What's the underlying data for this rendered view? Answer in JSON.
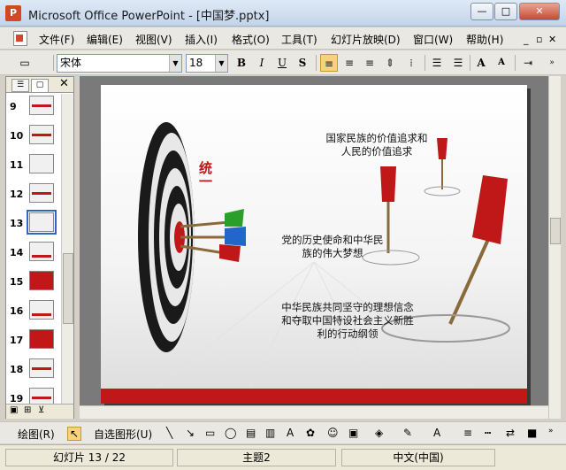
{
  "window": {
    "title": "Microsoft Office PowerPoint - [中国梦.pptx]"
  },
  "menu": {
    "items": [
      "文件(F)",
      "编辑(E)",
      "视图(V)",
      "插入(I)",
      "格式(O)",
      "工具(T)",
      "幻灯片放映(D)",
      "窗口(W)",
      "帮助(H)"
    ]
  },
  "format_toolbar": {
    "font_name": "宋体",
    "font_size": "18",
    "bold": "B",
    "italic": "I",
    "underline": "U",
    "shadow": "S"
  },
  "slide_pane": {
    "thumbnails": [
      {
        "num": "9"
      },
      {
        "num": "10"
      },
      {
        "num": "11"
      },
      {
        "num": "12"
      },
      {
        "num": "13"
      },
      {
        "num": "14"
      },
      {
        "num": "15"
      },
      {
        "num": "16"
      },
      {
        "num": "17"
      },
      {
        "num": "18"
      },
      {
        "num": "19"
      }
    ],
    "selected": "13"
  },
  "slide": {
    "vertical_title": "统一",
    "text1": [
      "国家民族的价值追求和",
      "人民的价值追求"
    ],
    "text2": [
      "党的历史使命和中华民",
      "族的伟大梦想"
    ],
    "text3": [
      "中华民族共同坚守的理想信念",
      "和夺取中国特设社会主义新胜",
      "利的行动纲领"
    ]
  },
  "draw_toolbar": {
    "draw_label": "绘图(R)",
    "autoshape_label": "自选图形(U)"
  },
  "status": {
    "slide_info": "幻灯片 13 / 22",
    "theme": "主题2",
    "language": "中文(中国)"
  },
  "colors": {
    "accent_red": "#c01818",
    "selection_blue": "#3166c6"
  }
}
